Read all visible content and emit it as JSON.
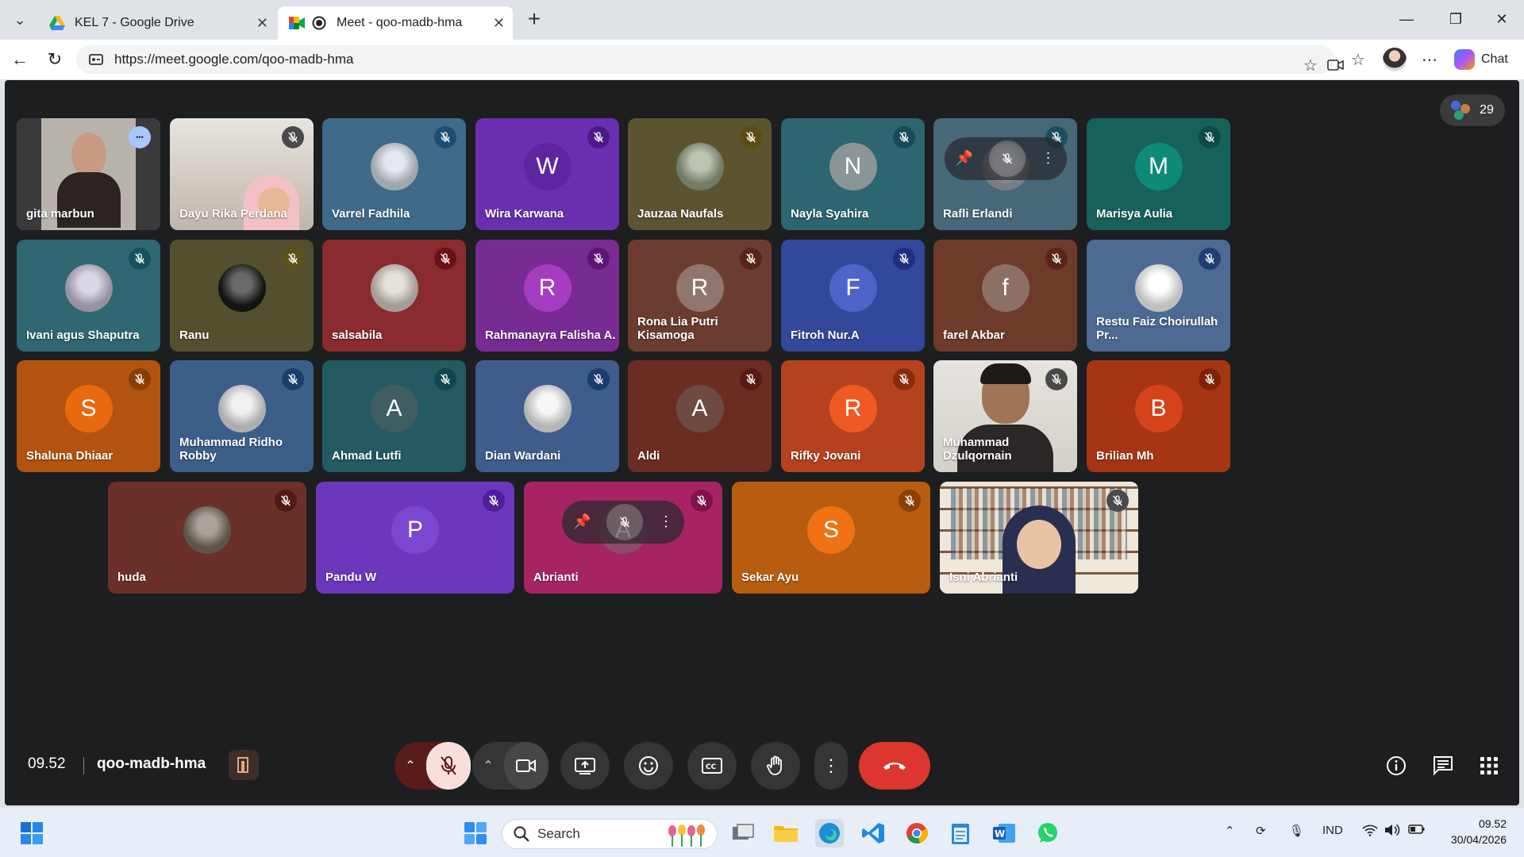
{
  "browser": {
    "tabs": [
      {
        "title": "KEL 7 - Google Drive",
        "icon": "google-drive-icon",
        "active": false
      },
      {
        "title": "Meet - qoo-madb-hma",
        "icon": "google-meet-icon",
        "active": true
      }
    ],
    "url": "https://meet.google.com/qoo-madb-hma",
    "chat_label": "Chat"
  },
  "meet": {
    "participant_count": "29",
    "time": "09.52",
    "meeting_code": "qoo-madb-hma",
    "participants": [
      {
        "name": "gita marbun",
        "bg": "#3a3a3c",
        "kind": "video",
        "mute_color": null,
        "more": true,
        "highlight": true
      },
      {
        "name": "Dayu Rika Perdana",
        "bg": "#cfc8c0",
        "kind": "video",
        "mute_color": "#4a4a4a"
      },
      {
        "name": "Varrel Fadhila",
        "bg": "#3f6a8a",
        "kind": "photo",
        "avatar_bg": "#d6dde6",
        "mute_color": "#1e4d74"
      },
      {
        "name": "Wira Karwana",
        "bg": "#6a2fb0",
        "kind": "letter",
        "letter": "W",
        "avatar_bg": "#5e24a2",
        "mute_color": "#4b1a88"
      },
      {
        "name": "Jauzaa Naufals",
        "bg": "#5b5430",
        "kind": "photo",
        "avatar_bg": "#9aa388",
        "mute_color": "#5a4e12"
      },
      {
        "name": "Nayla Syahira",
        "bg": "#2c6670",
        "kind": "letter",
        "letter": "N",
        "avatar_bg": "#8b9596",
        "mute_color": "#174b57"
      },
      {
        "name": "Rafli Erlandi",
        "bg": "#476879",
        "kind": "photo",
        "avatar_bg": "#9fa8ae",
        "mute_color": "#1c4e60",
        "hover": true
      },
      {
        "name": "Marisya Aulia",
        "bg": "#16625a",
        "kind": "letter",
        "letter": "M",
        "avatar_bg": "#0d8a78",
        "mute_color": "#0b4c44"
      },
      {
        "name": "Ivani agus Shaputra",
        "bg": "#2f6772",
        "kind": "photo",
        "avatar_bg": "#c8c3d8",
        "mute_color": "#16525e"
      },
      {
        "name": "Ranu",
        "bg": "#544f2e",
        "kind": "photo",
        "avatar_bg": "#1a1a1a",
        "mute_color": "#5b531a"
      },
      {
        "name": "salsabila",
        "bg": "#8a2b2f",
        "kind": "photo",
        "avatar_bg": "#d8d2c8",
        "mute_color": "#6a1118"
      },
      {
        "name": "Rahmanayra Falisha A.",
        "bg": "#772b93",
        "kind": "letter",
        "letter": "R",
        "avatar_bg": "#a63cc0",
        "mute_color": "#5d1676"
      },
      {
        "name": "Rona Lia Putri Kisamoga",
        "bg": "#6b3d31",
        "kind": "letter",
        "letter": "R",
        "avatar_bg": "#8f766f",
        "mute_color": "#572618"
      },
      {
        "name": "Fitroh Nur.A",
        "bg": "#33479b",
        "kind": "letter",
        "letter": "F",
        "avatar_bg": "#4f64c9",
        "mute_color": "#1f2f80"
      },
      {
        "name": "farel Akbar",
        "bg": "#6e3a2a",
        "kind": "letter",
        "letter": "f",
        "avatar_bg": "#8c7068",
        "mute_color": "#5a2418"
      },
      {
        "name": "Restu Faiz Choirullah Pr...",
        "bg": "#4c6a92",
        "kind": "photo",
        "avatar_bg": "#ffffff",
        "mute_color": "#1e3f73"
      },
      {
        "name": "Shaluna Dhiaar",
        "bg": "#b2540f",
        "kind": "letter",
        "letter": "S",
        "avatar_bg": "#e96a0e",
        "mute_color": "#8a3d06"
      },
      {
        "name": "Muhammad Ridho Robby",
        "bg": "#3c5f8a",
        "kind": "photo",
        "avatar_bg": "#e8e8e8",
        "mute_color": "#1c3d6e"
      },
      {
        "name": "Ahmad Lutfi",
        "bg": "#245a62",
        "kind": "letter",
        "letter": "A",
        "avatar_bg": "#405e62",
        "mute_color": "#0f4650"
      },
      {
        "name": "Dian Wardani",
        "bg": "#3f5d8c",
        "kind": "photo",
        "avatar_bg": "#f2f2f2",
        "mute_color": "#1c3b70"
      },
      {
        "name": "Aldi",
        "bg": "#6b2d22",
        "kind": "letter",
        "letter": "A",
        "avatar_bg": "#6d4a42",
        "mute_color": "#541c12"
      },
      {
        "name": "Rifky Jovani",
        "bg": "#b5421e",
        "kind": "letter",
        "letter": "R",
        "avatar_bg": "#f05a22",
        "mute_color": "#8a2c0c"
      },
      {
        "name": "Muhammad Dzulqornain",
        "bg": "#e3e0db",
        "kind": "video",
        "mute_color": "#4a4a4a"
      },
      {
        "name": "Brilian Mh",
        "bg": "#a63514",
        "kind": "letter",
        "letter": "B",
        "avatar_bg": "#d5431c",
        "mute_color": "#7c230a"
      },
      {
        "name": "huda",
        "bg": "#6b3029",
        "kind": "photo",
        "avatar_bg": "#7d7265",
        "mute_color": "#521a14"
      },
      {
        "name": "Pandu W",
        "bg": "#6c37bd",
        "kind": "letter",
        "letter": "P",
        "avatar_bg": "#7b46d0",
        "mute_color": "#4f1f9a"
      },
      {
        "name": "Abrianti",
        "bg": "#a72464",
        "kind": "letter",
        "letter": "A",
        "avatar_bg": "#8b4a66",
        "mute_color": "#7f124a",
        "hover": true
      },
      {
        "name": "Sekar Ayu",
        "bg": "#b85c10",
        "kind": "letter",
        "letter": "S",
        "avatar_bg": "#f07212",
        "mute_color": "#8a4104"
      },
      {
        "name": "Isni Abrianti",
        "bg": "#d2c6b2",
        "kind": "video",
        "mute_color": "#4a4a4a"
      }
    ]
  },
  "taskbar": {
    "search_placeholder": "Search",
    "language": "IND",
    "time": "09.52",
    "date": "30/04/2026"
  }
}
